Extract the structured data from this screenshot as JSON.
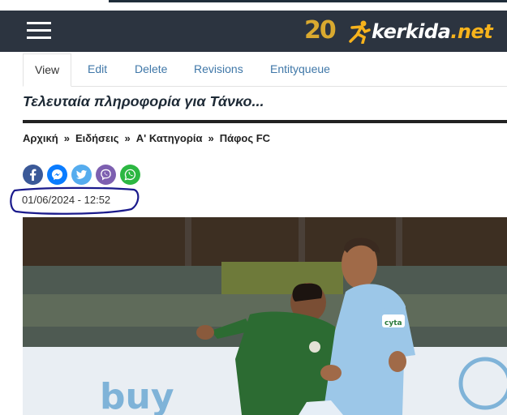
{
  "header": {
    "anniversary_badge": "20",
    "logo_text": "kerkida",
    "logo_suffix": ".net",
    "colors": {
      "bar": "#2c3440",
      "accent": "#f7b31c",
      "badge": "#d9a92f"
    }
  },
  "tabs": [
    {
      "label": "View",
      "active": true
    },
    {
      "label": "Edit",
      "active": false
    },
    {
      "label": "Delete",
      "active": false
    },
    {
      "label": "Revisions",
      "active": false
    },
    {
      "label": "Entityqueue",
      "active": false
    }
  ],
  "article": {
    "title": "Τελευταία πληροφορία για Τάνκο...",
    "date": "01/06/2024 - 12:52"
  },
  "breadcrumb": {
    "separator": "»",
    "items": [
      "Αρχική",
      "Ειδήσεις",
      "Α' Κατηγορία",
      "Πάφος FC"
    ]
  },
  "share": [
    {
      "icon": "facebook-icon",
      "color": "#3b5998"
    },
    {
      "icon": "messenger-icon",
      "color": "#0a7cff"
    },
    {
      "icon": "twitter-icon",
      "color": "#55acee"
    },
    {
      "icon": "viber-icon",
      "color": "#7d5fb0"
    },
    {
      "icon": "whatsapp-icon",
      "color": "#2cb742"
    }
  ],
  "photo": {
    "alt_subject": "football-players-photo",
    "visible_text": [
      "buy",
      "cyta"
    ]
  }
}
